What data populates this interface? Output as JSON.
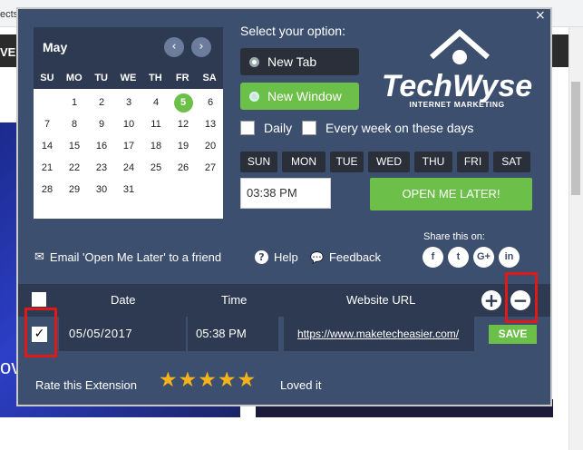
{
  "browser": {
    "tab_fragment": "ects",
    "nav_fragment": "VE",
    "hero_fragment": "ov"
  },
  "popup": {
    "close_icon": "×"
  },
  "calendar": {
    "month": "May",
    "prev_icon": "‹",
    "next_icon": "›",
    "weekdays": [
      "SU",
      "MO",
      "TU",
      "WE",
      "TH",
      "FR",
      "SA"
    ],
    "days": [
      "",
      "1",
      "2",
      "3",
      "4",
      "5",
      "6",
      "7",
      "8",
      "9",
      "10",
      "11",
      "12",
      "13",
      "14",
      "15",
      "16",
      "17",
      "18",
      "19",
      "20",
      "21",
      "22",
      "23",
      "24",
      "25",
      "26",
      "27",
      "28",
      "29",
      "30",
      "31",
      "",
      "",
      ""
    ],
    "today": "5"
  },
  "options": {
    "title": "Select your option:",
    "new_tab": "New Tab",
    "new_window": "New Window",
    "daily": "Daily",
    "every_week": "Every week on these days",
    "days": [
      "SUN",
      "MON",
      "TUE",
      "WED",
      "THU",
      "FRI",
      "SAT"
    ],
    "time_value": "03:38 PM",
    "open_later": "OPEN ME LATER!"
  },
  "logo": {
    "name": "TechWyse",
    "tagline": "INTERNET MARKETING"
  },
  "share": {
    "label": "Share this on:",
    "icons": [
      "f",
      "t",
      "G+",
      "in"
    ]
  },
  "links": {
    "email": "Email 'Open Me Later' to a friend",
    "help": "Help",
    "feedback": "Feedback",
    "email_icon": "✉",
    "help_icon": "?",
    "feedback_icon": "💬"
  },
  "table": {
    "headers": {
      "date": "Date",
      "time": "Time",
      "url": "Website URL"
    },
    "add_icon": "+",
    "remove_icon": "−",
    "rows": [
      {
        "checked": "✓",
        "date": "05/05/2017",
        "time": "05:38 PM",
        "url": "https://www.maketecheasier.com/",
        "action": "SAVE"
      }
    ]
  },
  "rating": {
    "label": "Rate this Extension",
    "stars": [
      "★",
      "★",
      "★",
      "★",
      "★"
    ],
    "comment": "Loved it"
  },
  "colors": {
    "panel": "#3d4f6e",
    "panel_dark": "#2e3a52",
    "accent_green": "#6cc04a",
    "star": "#f5b21a",
    "highlight": "#e01818"
  }
}
